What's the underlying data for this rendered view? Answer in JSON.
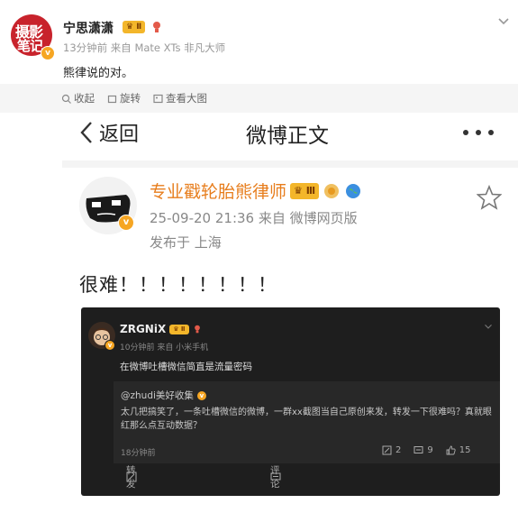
{
  "header": {
    "avatar_text_line1": "摄影",
    "avatar_text_line2": "笔记",
    "username": "宁思潇潇",
    "level_badge": "Ⅱ",
    "meta": "13分钟前  来自 Mate XTs 非凡大师",
    "text": "熊律说的对。"
  },
  "toolbar": {
    "collect": "收起",
    "rotate": "旋转",
    "view_large": "查看大图"
  },
  "post": {
    "nav_back": "返回",
    "nav_title": "微博正文",
    "author": "专业戳轮胎熊律师",
    "author_level": "Ⅲ",
    "date": "25-09-20 21:36  来自 微博网页版",
    "location": "发布于 上海",
    "text": "很难！！！！！！！！"
  },
  "screenshot": {
    "username": "ZRGNiX",
    "level": "Ⅱ",
    "meta": "10分钟前  来自 小米手机",
    "text": "在微博吐槽微信简直是流量密码",
    "quote_user": "@zhudi美好收集",
    "quote_text": "太几把搞笑了，一条吐槽微信的微博，一群xx截图当自己原创来发，转发一下很难吗？真就眼红那么点互动数据？",
    "quote_time": "18分钟前",
    "repost_count": "2",
    "comment_count": "9",
    "like_count": "15",
    "repost_label": "转发",
    "comment_label": "评论"
  },
  "colors": {
    "author": "#e77d1c",
    "avatar_red": "#c8232c",
    "dark_bg": "#1e1e1e",
    "badge_gold": "#f3b62a"
  }
}
